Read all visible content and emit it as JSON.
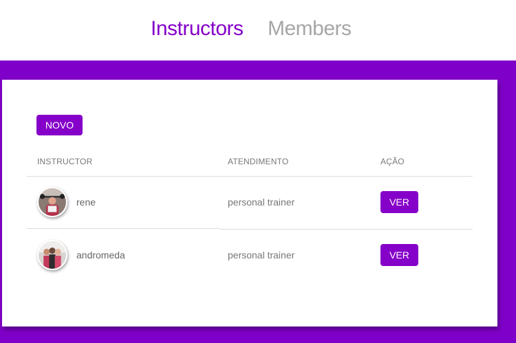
{
  "nav": {
    "active_label": "Instructors",
    "inactive_label": "Members"
  },
  "toolbar": {
    "new_label": "NOVO"
  },
  "table": {
    "headers": [
      "INSTRUCTOR",
      "ATENDIMENTO",
      "AÇÃO"
    ],
    "rows": [
      {
        "name": "rene",
        "service": "personal trainer",
        "action": "VER",
        "avatar_icon": "instructor-photo-icon"
      },
      {
        "name": "andromeda",
        "service": "personal trainer",
        "action": "VER",
        "avatar_icon": "instructor-photo-icon"
      }
    ]
  },
  "colors": {
    "accent": "#8500c9",
    "background": "#7f00c8",
    "muted_text": "#a6a6a6"
  }
}
